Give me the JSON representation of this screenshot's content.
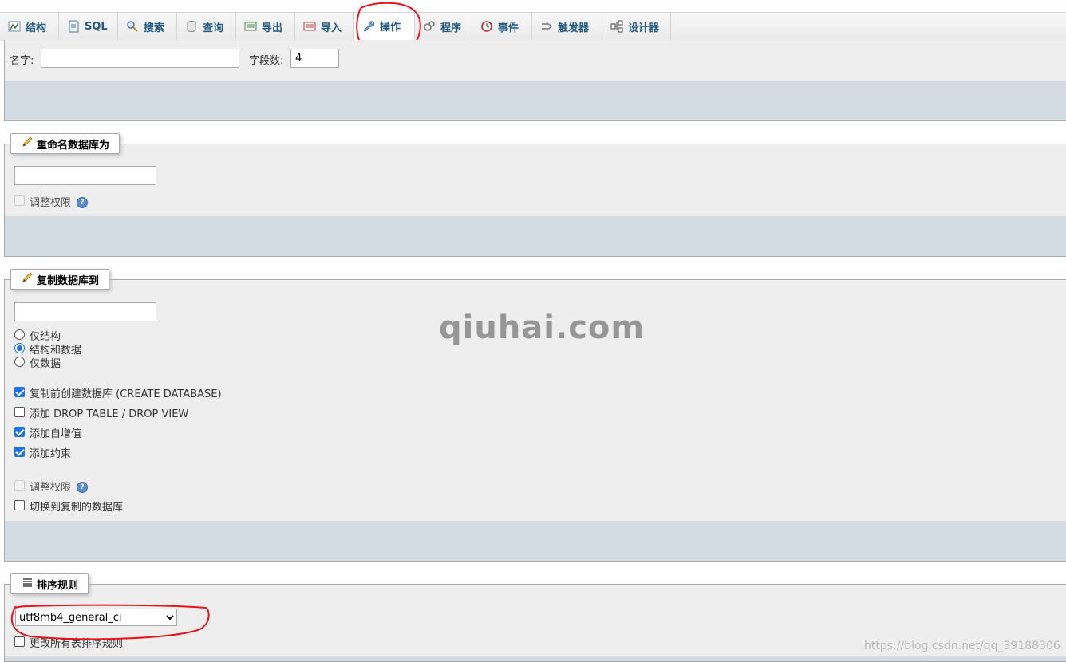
{
  "tabs": [
    {
      "label": "结构",
      "icon": "structure-icon"
    },
    {
      "label": "SQL",
      "icon": "sql-icon"
    },
    {
      "label": "搜索",
      "icon": "search-icon"
    },
    {
      "label": "查询",
      "icon": "query-icon"
    },
    {
      "label": "导出",
      "icon": "export-icon"
    },
    {
      "label": "导入",
      "icon": "import-icon"
    },
    {
      "label": "操作",
      "icon": "wrench-icon",
      "active": true
    },
    {
      "label": "程序",
      "icon": "routines-icon"
    },
    {
      "label": "事件",
      "icon": "events-icon"
    },
    {
      "label": "触发器",
      "icon": "triggers-icon"
    },
    {
      "label": "设计器",
      "icon": "designer-icon"
    }
  ],
  "create_table": {
    "name_label": "名字:",
    "name_value": "",
    "columns_label": "字段数:",
    "columns_value": "4"
  },
  "rename_db": {
    "legend": "重命名数据库为",
    "new_name_value": "",
    "adjust_privileges_label": "调整权限"
  },
  "copy_db": {
    "legend": "复制数据库到",
    "target_name_value": "",
    "radio_structure_only": "仅结构",
    "radio_structure_and_data": "结构和数据",
    "radio_data_only": "仅数据",
    "check_create_database": "复制前创建数据库 (CREATE DATABASE)",
    "check_drop_table": "添加 DROP TABLE / DROP VIEW",
    "check_auto_increment": "添加自增值",
    "check_constraints": "添加约束",
    "adjust_privileges_label": "调整权限",
    "check_switch_db": "切换到复制的数据库"
  },
  "collation": {
    "legend": "排序规则",
    "selected": "utf8mb4_general_ci",
    "change_all_tables_label": "更改所有表排序规则"
  },
  "watermark": "qiuhai.com",
  "csdn_watermark": "https://blog.csdn.net/qq_39188306",
  "colors": {
    "tab_text": "#235a81",
    "panel_bg": "#eeeeee",
    "panel_footer_bg": "#d3dce3",
    "checkbox_checked": "#1a73e8",
    "annotation_red": "#e8141c"
  }
}
